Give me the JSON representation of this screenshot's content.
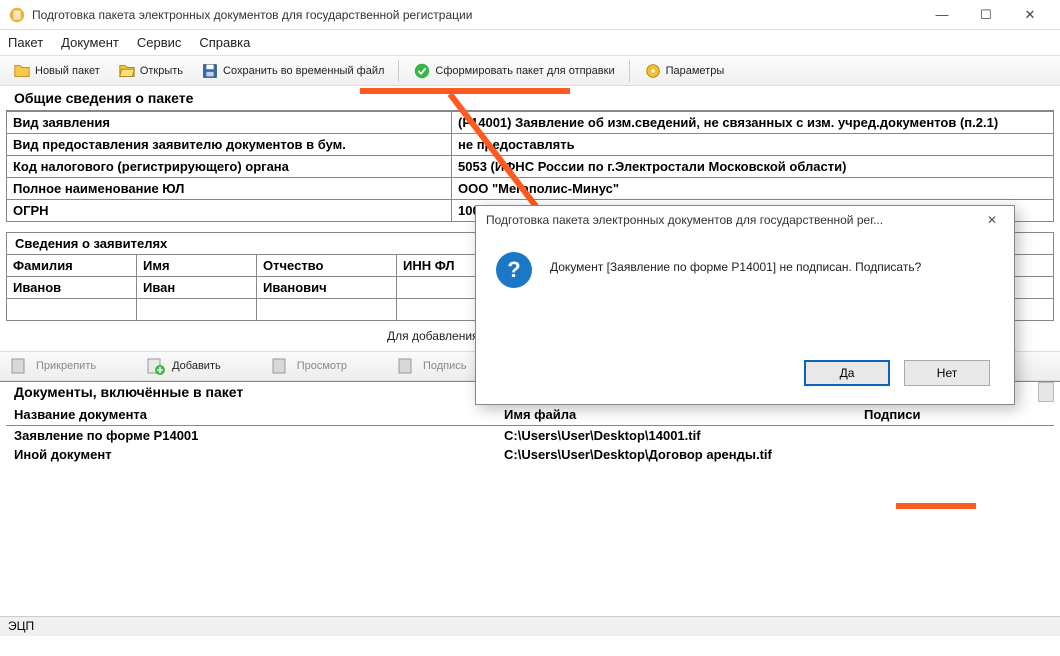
{
  "window": {
    "title": "Подготовка пакета электронных документов для государственной регистрации"
  },
  "menu": {
    "items": [
      "Пакет",
      "Документ",
      "Сервис",
      "Справка"
    ]
  },
  "toolbar": {
    "new_package": "Новый пакет",
    "open": "Открыть",
    "save_temp": "Сохранить во временный файл",
    "form_package": "Сформировать пакет для отправки",
    "params": "Параметры"
  },
  "general": {
    "title": "Общие сведения о пакете",
    "rows": [
      {
        "label": "Вид заявления",
        "value": "(Р14001) Заявление об изм.сведений, не связанных с изм. учред.документов (п.2.1)"
      },
      {
        "label": "Вид предоставления заявителю документов в бум.",
        "value": "не предоставлять"
      },
      {
        "label": "Код налогового (регистрирующего) органа",
        "value": "5053 (ИФНС России по г.Электростали Московской области)"
      },
      {
        "label": "Полное наименование ЮЛ",
        "value": "ООО \"Мегаполис-Минус\""
      },
      {
        "label": "ОГРН",
        "value": "1000054000"
      }
    ]
  },
  "applicants": {
    "title": "Сведения о заявителях",
    "columns": [
      "Фамилия",
      "Имя",
      "Отчество",
      "ИНН ФЛ"
    ],
    "rows": [
      {
        "lastname": "Иванов",
        "firstname": "Иван",
        "patronymic": "Иванович",
        "inn": ""
      }
    ],
    "hint": "Для добавления заявителя выберите последнего и"
  },
  "doc_tools": {
    "attach": "Прикрепить",
    "add": "Добавить",
    "view": "Просмотр",
    "sign": "Подпись"
  },
  "docs": {
    "title": "Документы, включённые в пакет",
    "columns": [
      "Название документа",
      "Имя файла",
      "Подписи"
    ],
    "rows": [
      {
        "name": "Заявление по форме Р14001",
        "file": "C:\\Users\\User\\Desktop\\14001.tif",
        "sign": ""
      },
      {
        "name": "Иной документ",
        "file": "C:\\Users\\User\\Desktop\\Договор аренды.tif",
        "sign": ""
      }
    ]
  },
  "dialog": {
    "title": "Подготовка пакета электронных документов для государственной рег...",
    "text": "Документ [Заявление по форме Р14001] не подписан. Подписать?",
    "yes": "Да",
    "no": "Нет"
  },
  "status": {
    "label": "ЭЦП"
  }
}
